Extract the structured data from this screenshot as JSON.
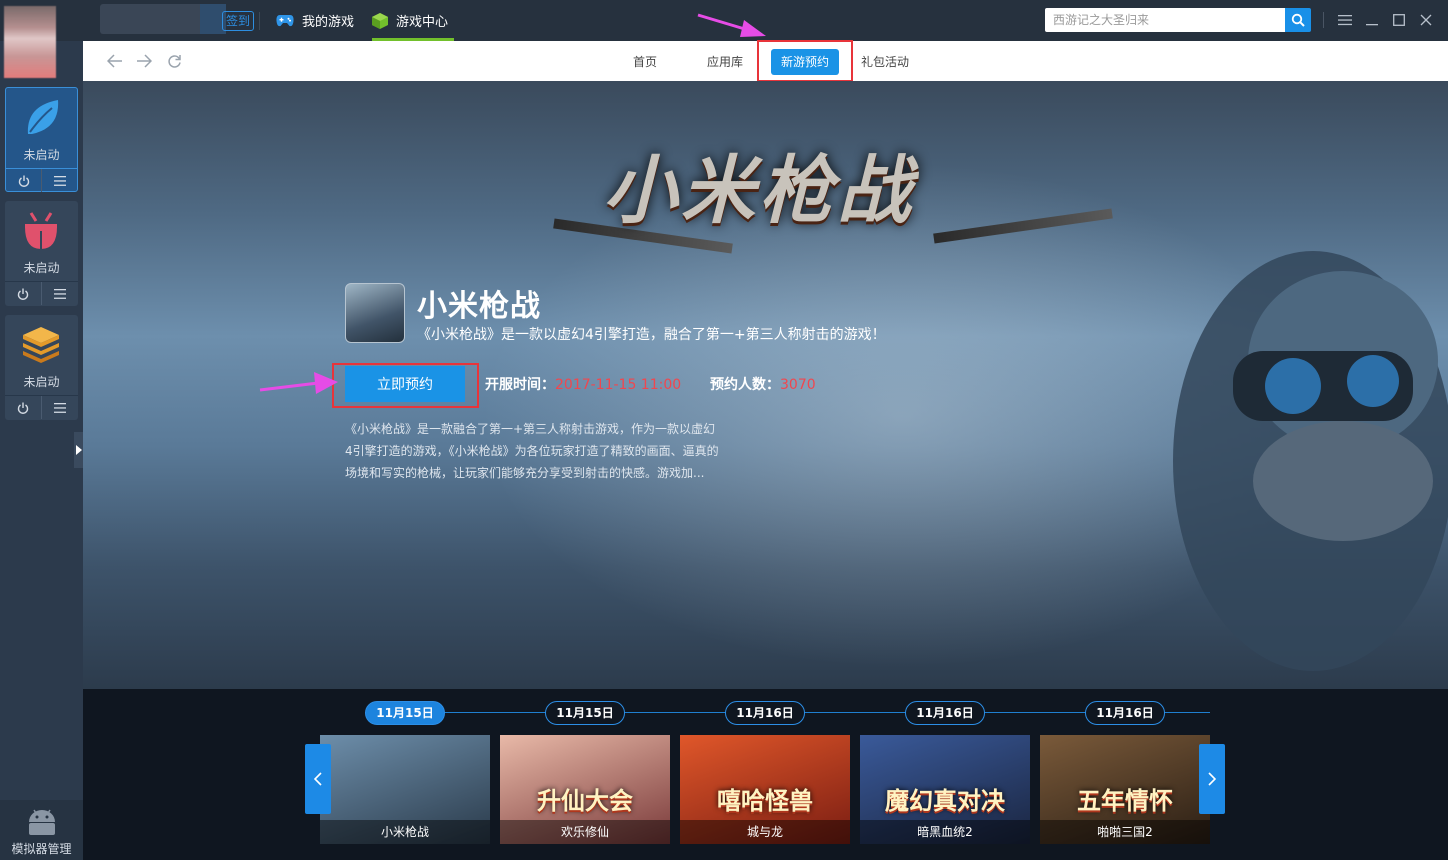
{
  "titlebar": {
    "checkin_label": "签到",
    "tabs": [
      {
        "label": "我的游戏"
      },
      {
        "label": "游戏中心"
      }
    ],
    "search_placeholder": "西游记之大圣归来"
  },
  "sidebar": {
    "emulators": [
      {
        "status": "未启动",
        "icon": "leaf-icon",
        "color": "#3aa0e8"
      },
      {
        "status": "未启动",
        "icon": "bug-icon",
        "color": "#e0516c"
      },
      {
        "status": "未启动",
        "icon": "layers-icon",
        "color": "#e39a2a"
      }
    ],
    "manager_label": "模拟器管理"
  },
  "nav": {
    "tabs": [
      {
        "label": "首页"
      },
      {
        "label": "应用库"
      },
      {
        "label": "新游预约",
        "active": true
      },
      {
        "label": "礼包活动"
      }
    ]
  },
  "banner": {
    "title_art": "小米枪战",
    "game_name": "小米枪战",
    "tagline": "《小米枪战》是一款以虚幻4引擎打造，融合了第一+第三人称射击的游戏！",
    "reserve_label": "立即预约",
    "open_time_label": "开服时间：",
    "open_time_value": "2017-11-15 11:00",
    "reservations_label": "预约人数：",
    "reservations_value": "3070",
    "description": "《小米枪战》是一款融合了第一+第三人称射击游戏，作为一款以虚幻4引擎打造的游戏，《小米枪战》为各位玩家打造了精致的画面、逼真的场境和写实的枪械，让玩家们能够充分享受到射击的快感。游戏加..."
  },
  "timeline": {
    "dates": [
      "11月15日",
      "11月15日",
      "11月16日",
      "11月16日",
      "11月16日"
    ],
    "cards": [
      {
        "name": "小米枪战",
        "art": "",
        "color1": "#6d8eaa",
        "color2": "#2a3a4a"
      },
      {
        "name": "欢乐修仙",
        "art": "升仙大会",
        "color1": "#e8b9a8",
        "color2": "#7a3a3a"
      },
      {
        "name": "城与龙",
        "art": "嘻哈怪兽",
        "color1": "#e0572a",
        "color2": "#7a1d12"
      },
      {
        "name": "暗黑血统2",
        "art": "魔幻真对决",
        "color1": "#3a5a9a",
        "color2": "#1a2540"
      },
      {
        "name": "啪啪三国2",
        "art": "五年情怀",
        "color1": "#7a5a3a",
        "color2": "#2a1e14"
      }
    ]
  }
}
